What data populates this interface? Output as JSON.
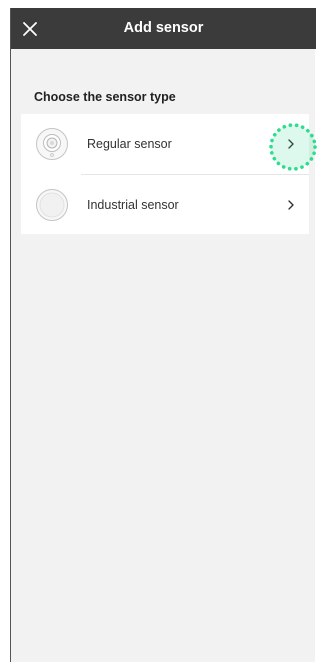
{
  "header": {
    "title": "Add sensor",
    "close_icon": "close-icon",
    "background": "#3b3b3b"
  },
  "section": {
    "title": "Choose the sensor type"
  },
  "sensor_types": [
    {
      "label": "Regular sensor",
      "icon": "regular-sensor-icon",
      "action_icon": "chevron-right-icon"
    },
    {
      "label": "Industrial sensor",
      "icon": "industrial-sensor-icon",
      "action_icon": "chevron-right-icon"
    }
  ],
  "tap_indicator": {
    "color": "#2ddc8c",
    "target": "Regular sensor"
  }
}
